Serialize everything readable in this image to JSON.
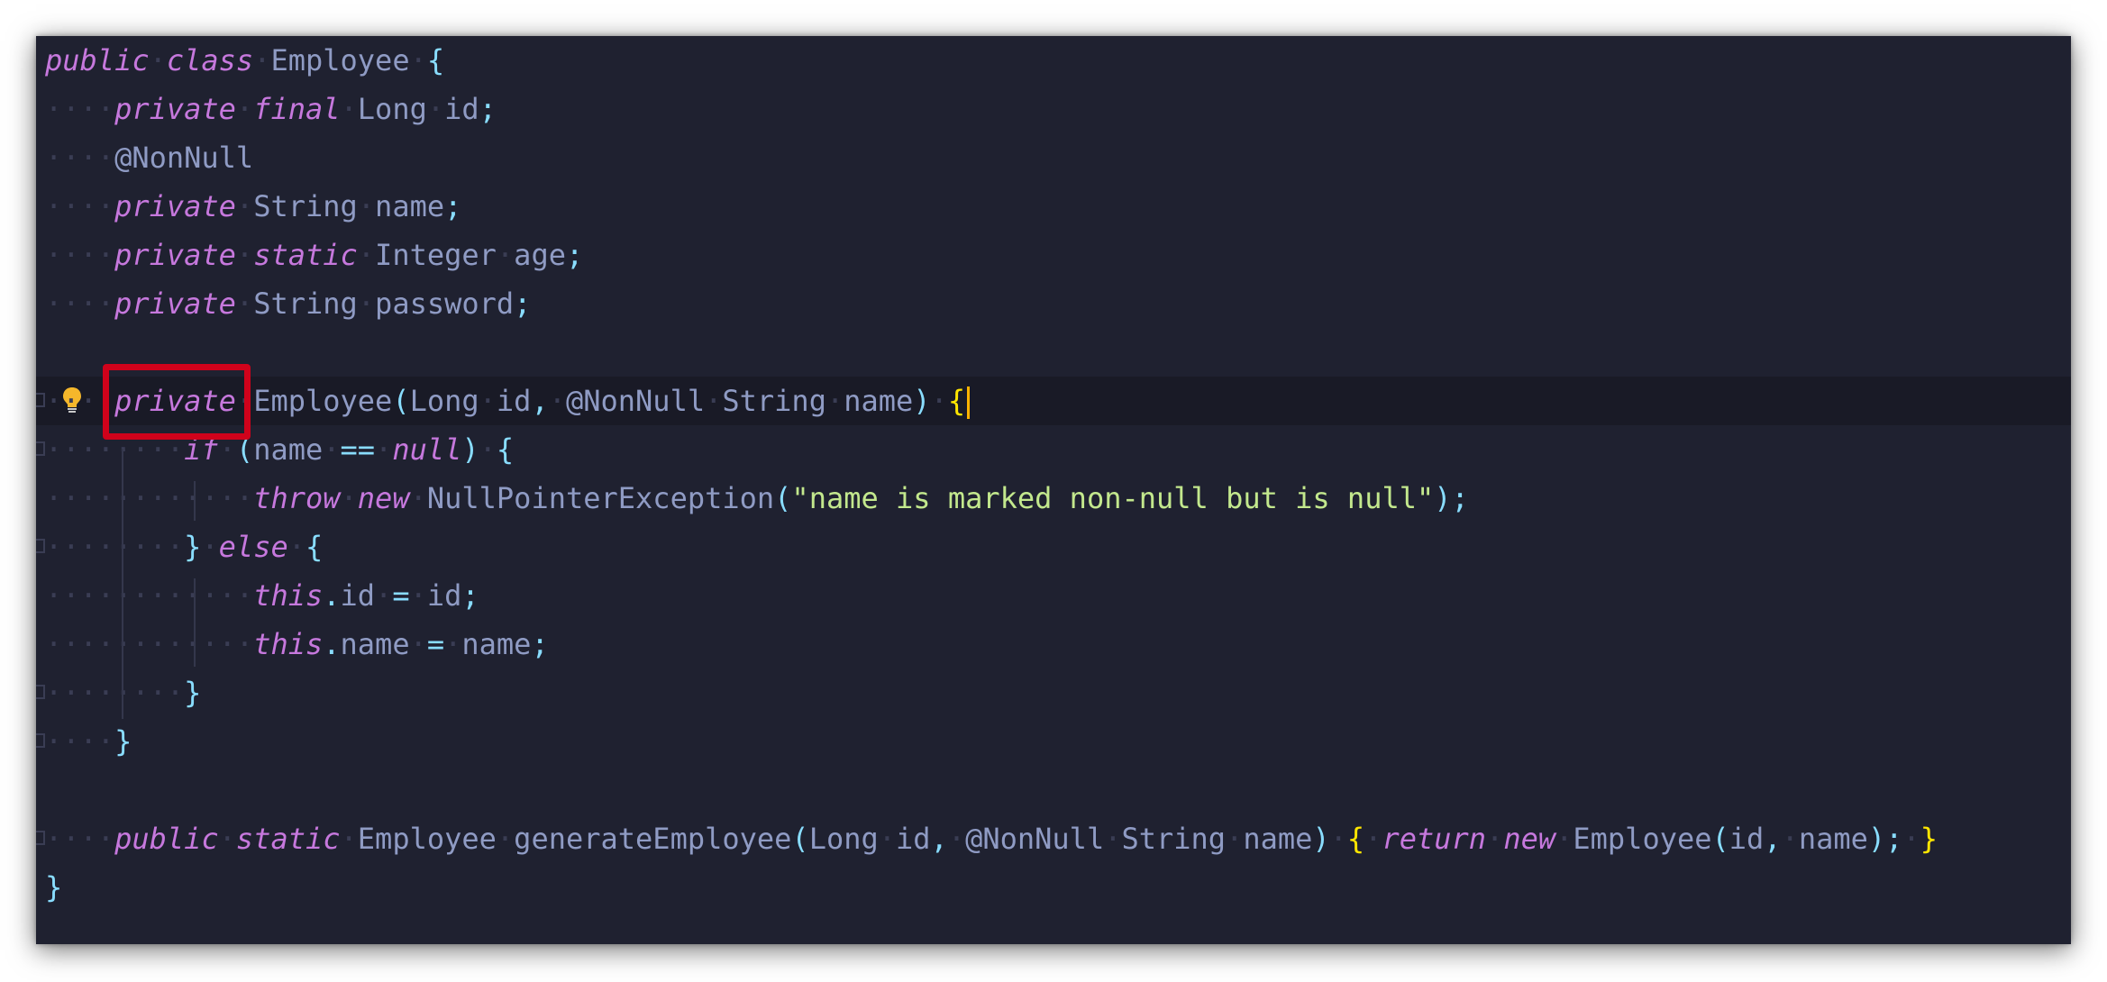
{
  "editor": {
    "lines": [
      {
        "segments": [
          [
            "kw",
            "public"
          ],
          [
            "ws",
            "·"
          ],
          [
            "kw",
            "class"
          ],
          [
            "ws",
            "·"
          ],
          [
            "ty",
            "Employee"
          ],
          [
            "ws",
            "·"
          ],
          [
            "br",
            "{"
          ]
        ]
      },
      {
        "segments": [
          [
            "ws",
            "····"
          ],
          [
            "kw",
            "private"
          ],
          [
            "ws",
            "·"
          ],
          [
            "kw",
            "final"
          ],
          [
            "ws",
            "·"
          ],
          [
            "ty",
            "Long"
          ],
          [
            "ws",
            "·"
          ],
          [
            "id",
            "id"
          ],
          [
            "pun",
            ";"
          ]
        ]
      },
      {
        "segments": [
          [
            "ws",
            "····"
          ],
          [
            "ann",
            "@NonNull"
          ]
        ]
      },
      {
        "segments": [
          [
            "ws",
            "····"
          ],
          [
            "kw",
            "private"
          ],
          [
            "ws",
            "·"
          ],
          [
            "ty",
            "String"
          ],
          [
            "ws",
            "·"
          ],
          [
            "id",
            "name"
          ],
          [
            "pun",
            ";"
          ]
        ]
      },
      {
        "segments": [
          [
            "ws",
            "····"
          ],
          [
            "kw",
            "private"
          ],
          [
            "ws",
            "·"
          ],
          [
            "kw",
            "static"
          ],
          [
            "ws",
            "·"
          ],
          [
            "ty",
            "Integer"
          ],
          [
            "ws",
            "·"
          ],
          [
            "id",
            "age"
          ],
          [
            "pun",
            ";"
          ]
        ]
      },
      {
        "segments": [
          [
            "ws",
            "····"
          ],
          [
            "kw",
            "private"
          ],
          [
            "ws",
            "·"
          ],
          [
            "ty",
            "String"
          ],
          [
            "ws",
            "·"
          ],
          [
            "id",
            "password"
          ],
          [
            "pun",
            ";"
          ]
        ]
      },
      {
        "segments": []
      },
      {
        "current": true,
        "bulb": true,
        "gutter": true,
        "segments": [
          [
            "ws",
            "····"
          ],
          [
            "kw",
            "private"
          ],
          [
            "ws",
            "·"
          ],
          [
            "ty",
            "Employee"
          ],
          [
            "pun",
            "("
          ],
          [
            "ty",
            "Long"
          ],
          [
            "ws",
            "·"
          ],
          [
            "id",
            "id"
          ],
          [
            "pun",
            ","
          ],
          [
            "ws",
            "·"
          ],
          [
            "ann",
            "@NonNull"
          ],
          [
            "ws",
            "·"
          ],
          [
            "ty",
            "String"
          ],
          [
            "ws",
            "·"
          ],
          [
            "id",
            "name"
          ],
          [
            "pun",
            ")"
          ],
          [
            "ws",
            "·"
          ],
          [
            "ybr",
            "{"
          ]
        ],
        "caret": true
      },
      {
        "gutter": true,
        "segments": [
          [
            "ws",
            "········"
          ],
          [
            "kw",
            "if"
          ],
          [
            "ws",
            "·"
          ],
          [
            "pun",
            "("
          ],
          [
            "id",
            "name"
          ],
          [
            "ws",
            "·"
          ],
          [
            "pun",
            "=="
          ],
          [
            "ws",
            "·"
          ],
          [
            "kw",
            "null"
          ],
          [
            "pun",
            ")"
          ],
          [
            "ws",
            "·"
          ],
          [
            "br",
            "{"
          ]
        ]
      },
      {
        "segments": [
          [
            "ws",
            "············"
          ],
          [
            "kw",
            "throw"
          ],
          [
            "ws",
            "·"
          ],
          [
            "kw",
            "new"
          ],
          [
            "ws",
            "·"
          ],
          [
            "ty",
            "NullPointerException"
          ],
          [
            "pun",
            "("
          ],
          [
            "str",
            "\"name is marked non-null but is null\""
          ],
          [
            "pun",
            ")"
          ],
          [
            "pun",
            ";"
          ]
        ]
      },
      {
        "gutter": true,
        "segments": [
          [
            "ws",
            "········"
          ],
          [
            "br",
            "}"
          ],
          [
            "ws",
            "·"
          ],
          [
            "kw",
            "else"
          ],
          [
            "ws",
            "·"
          ],
          [
            "br",
            "{"
          ]
        ]
      },
      {
        "segments": [
          [
            "ws",
            "············"
          ],
          [
            "kw",
            "this"
          ],
          [
            "pun",
            "."
          ],
          [
            "id",
            "id"
          ],
          [
            "ws",
            "·"
          ],
          [
            "pun",
            "="
          ],
          [
            "ws",
            "·"
          ],
          [
            "id",
            "id"
          ],
          [
            "pun",
            ";"
          ]
        ]
      },
      {
        "segments": [
          [
            "ws",
            "············"
          ],
          [
            "kw",
            "this"
          ],
          [
            "pun",
            "."
          ],
          [
            "id",
            "name"
          ],
          [
            "ws",
            "·"
          ],
          [
            "pun",
            "="
          ],
          [
            "ws",
            "·"
          ],
          [
            "id",
            "name"
          ],
          [
            "pun",
            ";"
          ]
        ]
      },
      {
        "gutter": true,
        "segments": [
          [
            "ws",
            "········"
          ],
          [
            "br",
            "}"
          ]
        ]
      },
      {
        "gutter": true,
        "segments": [
          [
            "ws",
            "····"
          ],
          [
            "br",
            "}"
          ]
        ]
      },
      {
        "segments": []
      },
      {
        "gutter": true,
        "segments": [
          [
            "ws",
            "····"
          ],
          [
            "kw",
            "public"
          ],
          [
            "ws",
            "·"
          ],
          [
            "kw",
            "static"
          ],
          [
            "ws",
            "·"
          ],
          [
            "ty",
            "Employee"
          ],
          [
            "ws",
            "·"
          ],
          [
            "id",
            "generateEmployee"
          ],
          [
            "pun",
            "("
          ],
          [
            "ty",
            "Long"
          ],
          [
            "ws",
            "·"
          ],
          [
            "id",
            "id"
          ],
          [
            "pun",
            ","
          ],
          [
            "ws",
            "·"
          ],
          [
            "ann",
            "@NonNull"
          ],
          [
            "ws",
            "·"
          ],
          [
            "ty",
            "String"
          ],
          [
            "ws",
            "·"
          ],
          [
            "id",
            "name"
          ],
          [
            "pun",
            ")"
          ],
          [
            "ws",
            "·"
          ],
          [
            "ybr",
            "{"
          ],
          [
            "ws",
            "·"
          ],
          [
            "kw",
            "return"
          ],
          [
            "ws",
            "·"
          ],
          [
            "kw",
            "new"
          ],
          [
            "ws",
            "·"
          ],
          [
            "ty",
            "Employee"
          ],
          [
            "pun",
            "("
          ],
          [
            "id",
            "id"
          ],
          [
            "pun",
            ","
          ],
          [
            "ws",
            "·"
          ],
          [
            "id",
            "name"
          ],
          [
            "pun",
            ")"
          ],
          [
            "pun",
            ";"
          ],
          [
            "ws",
            "·"
          ],
          [
            "ybr",
            "}"
          ]
        ]
      },
      {
        "segments": [
          [
            "br",
            "}"
          ]
        ]
      }
    ]
  },
  "colors": {
    "background": "#1f2130",
    "keyword": "#c678dd",
    "type": "#8f9bc4",
    "punctuation": "#89ddff",
    "string": "#c3e88d",
    "highlight_box": "#d0021b",
    "caret": "#ffb300"
  },
  "icons": {
    "bulb": "lightbulb-icon",
    "fold": "fold-marker-icon"
  }
}
